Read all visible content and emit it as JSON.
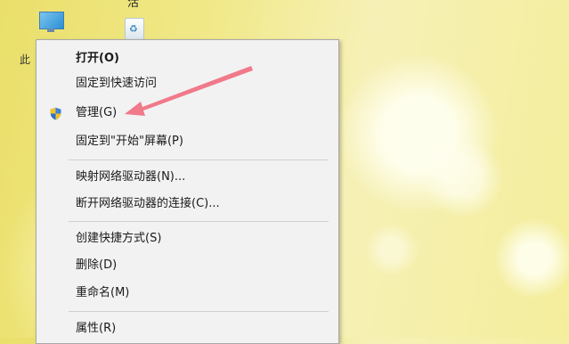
{
  "desktop": {
    "left_label": "此",
    "top_partial_text": "活"
  },
  "context_menu": {
    "items": [
      {
        "label": "打开(O)",
        "bold": true
      },
      {
        "label": "固定到快速访问"
      },
      {
        "label": "管理(G)",
        "icon": "uac-shield-icon"
      },
      {
        "label": "固定到\"开始\"屏幕(P)"
      },
      {
        "label": "映射网络驱动器(N)..."
      },
      {
        "label": "断开网络驱动器的连接(C)..."
      },
      {
        "label": "创建快捷方式(S)"
      },
      {
        "label": "删除(D)"
      },
      {
        "label": "重命名(M)"
      },
      {
        "label": "属性(R)"
      }
    ]
  },
  "annotation": {
    "arrow_color": "#ef6b7e"
  }
}
